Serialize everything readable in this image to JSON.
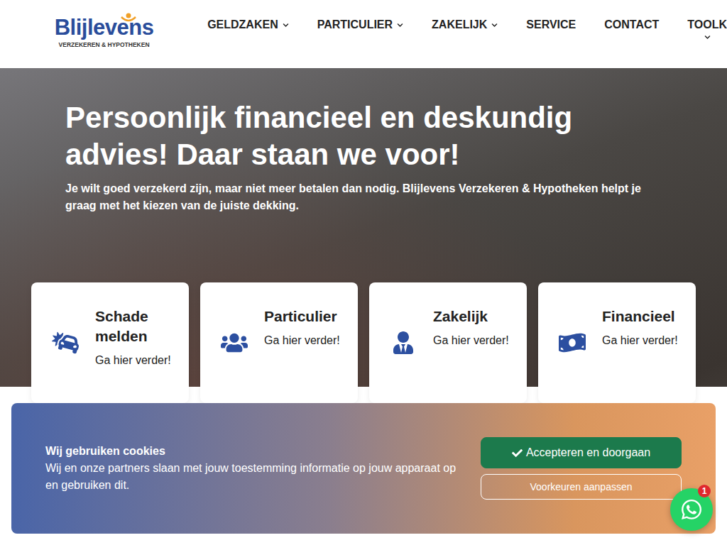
{
  "header": {
    "logo": {
      "name": "Blijlevens",
      "tagline": "VERZEKEREN & HYPOTHEKEN"
    },
    "nav": [
      {
        "label": "GELDZAKEN",
        "dropdown": true
      },
      {
        "label": "PARTICULIER",
        "dropdown": true
      },
      {
        "label": "ZAKELIJK",
        "dropdown": true
      },
      {
        "label": "SERVICE",
        "dropdown": false
      },
      {
        "label": "CONTACT",
        "dropdown": false
      },
      {
        "label": "TOOLK",
        "dropdown": true
      }
    ]
  },
  "hero": {
    "title": "Persoonlijk financieel en deskundig advies! Daar staan we voor!",
    "subtitle": "Je wilt goed verzekerd zijn, maar niet meer betalen dan nodig. Blijlevens Verzekeren & Hypotheken helpt je graag met het kiezen van de juiste dekking."
  },
  "cards": [
    {
      "kind": "damage",
      "title": "Schade melden",
      "link": "Ga hier verder!"
    },
    {
      "kind": "private",
      "title": "Particulier",
      "link": "Ga hier verder!"
    },
    {
      "kind": "business",
      "title": "Zakelijk",
      "link": "Ga hier verder!"
    },
    {
      "kind": "finance",
      "title": "Financieel",
      "link": "Ga hier verder!"
    }
  ],
  "cookie_banner": {
    "title": "Wij gebruiken cookies",
    "text": "Wij en onze partners slaan met jouw toestemming informatie op jouw apparaat op en gebruiken dit.",
    "buttons": [
      {
        "label": "Accepteren en doorgaan",
        "kind": "primary"
      },
      {
        "label": "Voorkeuren aanpassen",
        "kind": "secondary"
      }
    ]
  },
  "whatsapp": {
    "badge": "1"
  }
}
